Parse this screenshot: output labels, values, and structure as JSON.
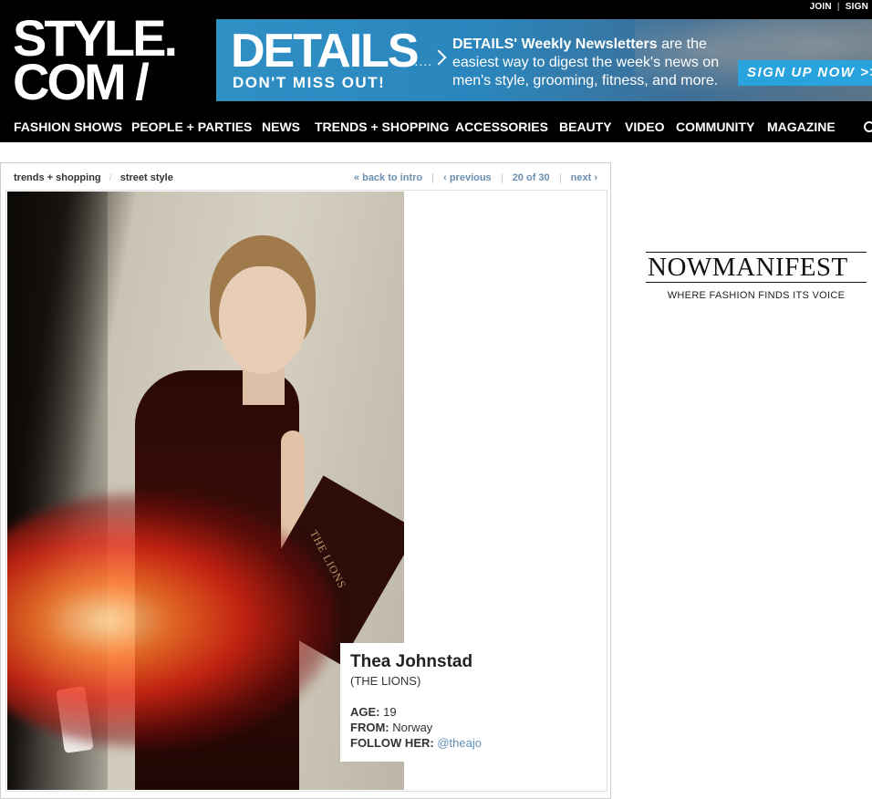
{
  "top_links": {
    "join": "JOIN",
    "sign": "SIGN"
  },
  "logo": {
    "line1": "STYLE.",
    "line2": "COM /"
  },
  "banner": {
    "brand": "DETAILS",
    "dont_miss": "DON'T MISS OUT!",
    "dots": "........",
    "copy_bold": "DETAILS' Weekly Newsletters",
    "copy_rest": " are the easiest way to digest the week's news on men's style, grooming, fitness, and more.",
    "signup": "SIGN UP NOW >>"
  },
  "nav": {
    "items": [
      {
        "label": "FASHION SHOWS"
      },
      {
        "label": "PEOPLE + PARTIES"
      },
      {
        "label": "NEWS"
      },
      {
        "label": "TRENDS + SHOPPING"
      },
      {
        "label": "ACCESSORIES"
      },
      {
        "label": "BEAUTY"
      },
      {
        "label": "VIDEO"
      },
      {
        "label": "COMMUNITY"
      },
      {
        "label": "MAGAZINE"
      }
    ]
  },
  "breadcrumb": {
    "section": "trends + shopping",
    "subsection": "street style"
  },
  "pager": {
    "back": "« back to intro",
    "previous": "‹ previous",
    "count": "20 of 30",
    "next": "next ›"
  },
  "photo": {
    "folio_text": "THE LIONS"
  },
  "caption": {
    "name": "Thea Johnstad",
    "company": "(THE LIONS)",
    "age_label": "AGE:",
    "age": "19",
    "from_label": "FROM:",
    "from": "Norway",
    "follow_label": "FOLLOW HER:",
    "handle": "@theajo"
  },
  "ad_right": {
    "wordmark": "NOWMANIFEST",
    "tagline": "WHERE FASHION FINDS ITS VOICE"
  }
}
